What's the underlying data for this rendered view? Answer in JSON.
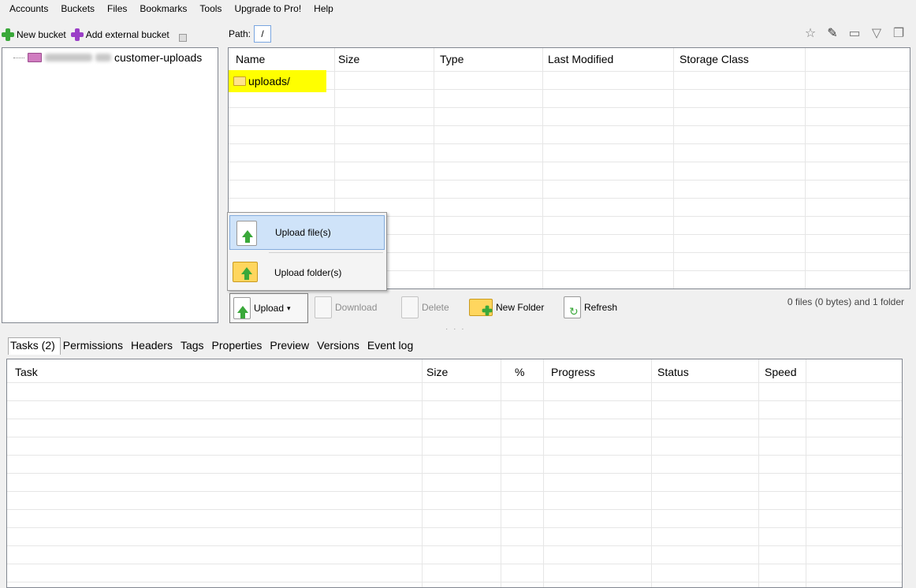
{
  "menu": [
    "Accounts",
    "Buckets",
    "Files",
    "Bookmarks",
    "Tools",
    "Upgrade to Pro!",
    "Help"
  ],
  "left_toolbar": {
    "new_bucket": "New bucket",
    "add_external_bucket": "Add external bucket"
  },
  "tree": {
    "bucket_name": "customer-uploads"
  },
  "path": {
    "label": "Path:",
    "value": "/"
  },
  "file_table": {
    "columns": [
      "Name",
      "Size",
      "Type",
      "Last Modified",
      "Storage Class"
    ],
    "rows": [
      {
        "name": "uploads/"
      }
    ]
  },
  "upload_menu": {
    "items": [
      "Upload file(s)",
      "Upload folder(s)"
    ],
    "highlighted": "Upload file(s)"
  },
  "file_toolbar": {
    "upload": "Upload",
    "download": "Download",
    "delete": "Delete",
    "new_folder": "New Folder",
    "refresh": "Refresh",
    "status": "0 files (0 bytes) and 1 folder"
  },
  "tabs": [
    "Tasks (2)",
    "Permissions",
    "Headers",
    "Tags",
    "Properties",
    "Preview",
    "Versions",
    "Event log"
  ],
  "task_table": {
    "columns": [
      "Task",
      "Size",
      "%",
      "Progress",
      "Status",
      "Speed"
    ]
  },
  "colors": {
    "highlight_yellow": "#ffff00",
    "menu_highlight": "#cfe3f9",
    "accent_green": "#3aa83a",
    "bucket_purple": "#9b3fc7"
  }
}
